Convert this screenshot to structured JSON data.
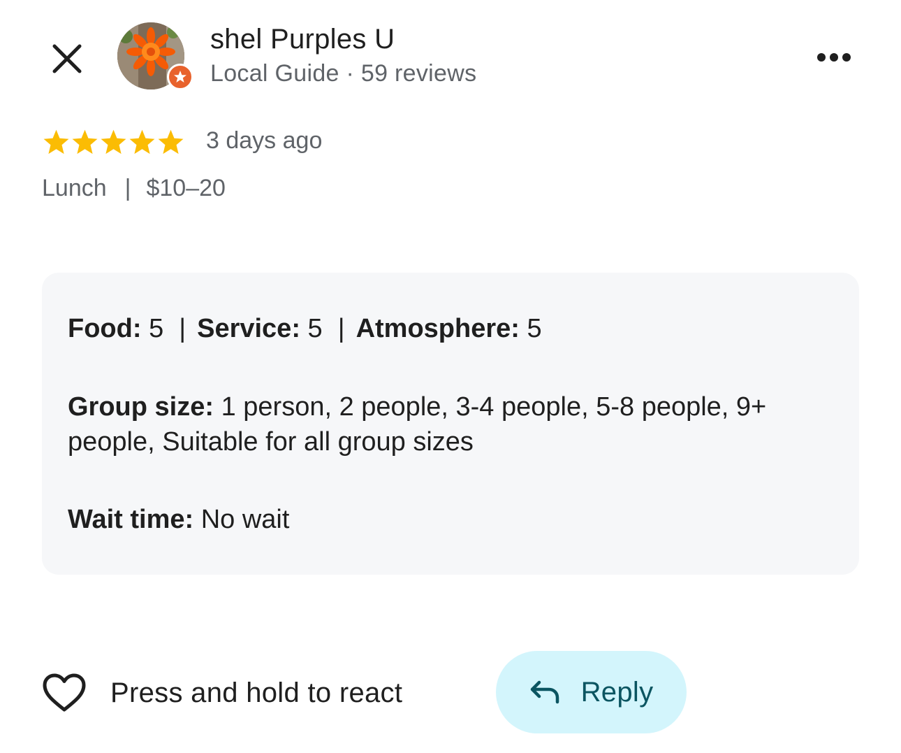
{
  "header": {
    "close_icon": "close-icon",
    "user_name": "shel Purples U",
    "user_meta": "Local Guide · 59 reviews",
    "more_icon": "more-horizontal-icon"
  },
  "review": {
    "rating": 5,
    "rating_max": 5,
    "date": "3 days ago",
    "meal_type": "Lunch",
    "meal_separator": "|",
    "price_range": "$10–20"
  },
  "details": {
    "food_label": "Food:",
    "food_value": "5",
    "service_label": "Service:",
    "service_value": "5",
    "atmosphere_label": "Atmosphere:",
    "atmosphere_value": "5",
    "separator": "|",
    "group_label": "Group size:",
    "group_value": "1 person, 2 people, 3-4 people, 5-8 people, 9+ people, Suitable for all group sizes",
    "wait_label": "Wait time:",
    "wait_value": "No wait"
  },
  "actions": {
    "react_label": "Press and hold to react",
    "reply_label": "Reply"
  },
  "colors": {
    "star": "#fbbc04",
    "guide_badge": "#e8622c",
    "reply_bg": "#d3f5fc",
    "reply_text": "#0b5561",
    "details_bg": "#f6f7f9",
    "muted_text": "#5f6368"
  }
}
